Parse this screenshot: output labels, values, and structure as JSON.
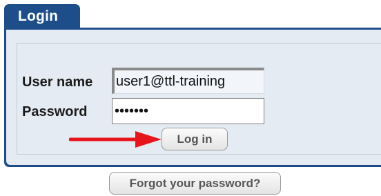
{
  "tab": {
    "label": "Login"
  },
  "form": {
    "username_label": "User name",
    "username_value": "user1@ttl-training",
    "password_label": "Password",
    "password_value": "•••••••",
    "login_label": "Log in"
  },
  "forgot_label": "Forgot your password?",
  "colors": {
    "tab_background": "#1d4e8a",
    "panel_background": "#e4ebf3",
    "arrow": "#e8141b"
  },
  "icons": {
    "pointer_arrow": "arrow-right-icon"
  }
}
